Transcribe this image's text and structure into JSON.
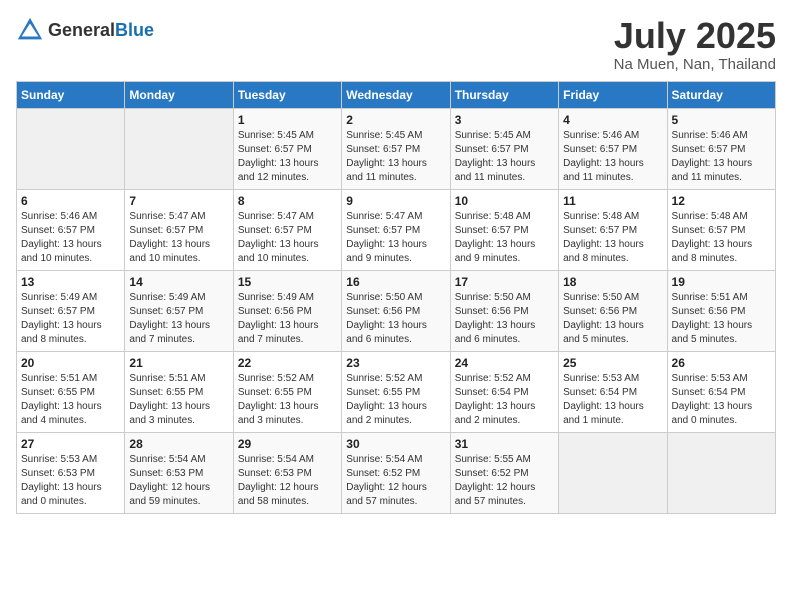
{
  "header": {
    "logo_general": "General",
    "logo_blue": "Blue",
    "month": "July 2025",
    "location": "Na Muen, Nan, Thailand"
  },
  "days_of_week": [
    "Sunday",
    "Monday",
    "Tuesday",
    "Wednesday",
    "Thursday",
    "Friday",
    "Saturday"
  ],
  "weeks": [
    [
      {
        "day": "",
        "sunrise": "",
        "sunset": "",
        "daylight": "",
        "empty": true
      },
      {
        "day": "",
        "sunrise": "",
        "sunset": "",
        "daylight": "",
        "empty": true
      },
      {
        "day": "1",
        "sunrise": "Sunrise: 5:45 AM",
        "sunset": "Sunset: 6:57 PM",
        "daylight": "Daylight: 13 hours and 12 minutes."
      },
      {
        "day": "2",
        "sunrise": "Sunrise: 5:45 AM",
        "sunset": "Sunset: 6:57 PM",
        "daylight": "Daylight: 13 hours and 11 minutes."
      },
      {
        "day": "3",
        "sunrise": "Sunrise: 5:45 AM",
        "sunset": "Sunset: 6:57 PM",
        "daylight": "Daylight: 13 hours and 11 minutes."
      },
      {
        "day": "4",
        "sunrise": "Sunrise: 5:46 AM",
        "sunset": "Sunset: 6:57 PM",
        "daylight": "Daylight: 13 hours and 11 minutes."
      },
      {
        "day": "5",
        "sunrise": "Sunrise: 5:46 AM",
        "sunset": "Sunset: 6:57 PM",
        "daylight": "Daylight: 13 hours and 11 minutes."
      }
    ],
    [
      {
        "day": "6",
        "sunrise": "Sunrise: 5:46 AM",
        "sunset": "Sunset: 6:57 PM",
        "daylight": "Daylight: 13 hours and 10 minutes."
      },
      {
        "day": "7",
        "sunrise": "Sunrise: 5:47 AM",
        "sunset": "Sunset: 6:57 PM",
        "daylight": "Daylight: 13 hours and 10 minutes."
      },
      {
        "day": "8",
        "sunrise": "Sunrise: 5:47 AM",
        "sunset": "Sunset: 6:57 PM",
        "daylight": "Daylight: 13 hours and 10 minutes."
      },
      {
        "day": "9",
        "sunrise": "Sunrise: 5:47 AM",
        "sunset": "Sunset: 6:57 PM",
        "daylight": "Daylight: 13 hours and 9 minutes."
      },
      {
        "day": "10",
        "sunrise": "Sunrise: 5:48 AM",
        "sunset": "Sunset: 6:57 PM",
        "daylight": "Daylight: 13 hours and 9 minutes."
      },
      {
        "day": "11",
        "sunrise": "Sunrise: 5:48 AM",
        "sunset": "Sunset: 6:57 PM",
        "daylight": "Daylight: 13 hours and 8 minutes."
      },
      {
        "day": "12",
        "sunrise": "Sunrise: 5:48 AM",
        "sunset": "Sunset: 6:57 PM",
        "daylight": "Daylight: 13 hours and 8 minutes."
      }
    ],
    [
      {
        "day": "13",
        "sunrise": "Sunrise: 5:49 AM",
        "sunset": "Sunset: 6:57 PM",
        "daylight": "Daylight: 13 hours and 8 minutes."
      },
      {
        "day": "14",
        "sunrise": "Sunrise: 5:49 AM",
        "sunset": "Sunset: 6:57 PM",
        "daylight": "Daylight: 13 hours and 7 minutes."
      },
      {
        "day": "15",
        "sunrise": "Sunrise: 5:49 AM",
        "sunset": "Sunset: 6:56 PM",
        "daylight": "Daylight: 13 hours and 7 minutes."
      },
      {
        "day": "16",
        "sunrise": "Sunrise: 5:50 AM",
        "sunset": "Sunset: 6:56 PM",
        "daylight": "Daylight: 13 hours and 6 minutes."
      },
      {
        "day": "17",
        "sunrise": "Sunrise: 5:50 AM",
        "sunset": "Sunset: 6:56 PM",
        "daylight": "Daylight: 13 hours and 6 minutes."
      },
      {
        "day": "18",
        "sunrise": "Sunrise: 5:50 AM",
        "sunset": "Sunset: 6:56 PM",
        "daylight": "Daylight: 13 hours and 5 minutes."
      },
      {
        "day": "19",
        "sunrise": "Sunrise: 5:51 AM",
        "sunset": "Sunset: 6:56 PM",
        "daylight": "Daylight: 13 hours and 5 minutes."
      }
    ],
    [
      {
        "day": "20",
        "sunrise": "Sunrise: 5:51 AM",
        "sunset": "Sunset: 6:55 PM",
        "daylight": "Daylight: 13 hours and 4 minutes."
      },
      {
        "day": "21",
        "sunrise": "Sunrise: 5:51 AM",
        "sunset": "Sunset: 6:55 PM",
        "daylight": "Daylight: 13 hours and 3 minutes."
      },
      {
        "day": "22",
        "sunrise": "Sunrise: 5:52 AM",
        "sunset": "Sunset: 6:55 PM",
        "daylight": "Daylight: 13 hours and 3 minutes."
      },
      {
        "day": "23",
        "sunrise": "Sunrise: 5:52 AM",
        "sunset": "Sunset: 6:55 PM",
        "daylight": "Daylight: 13 hours and 2 minutes."
      },
      {
        "day": "24",
        "sunrise": "Sunrise: 5:52 AM",
        "sunset": "Sunset: 6:54 PM",
        "daylight": "Daylight: 13 hours and 2 minutes."
      },
      {
        "day": "25",
        "sunrise": "Sunrise: 5:53 AM",
        "sunset": "Sunset: 6:54 PM",
        "daylight": "Daylight: 13 hours and 1 minute."
      },
      {
        "day": "26",
        "sunrise": "Sunrise: 5:53 AM",
        "sunset": "Sunset: 6:54 PM",
        "daylight": "Daylight: 13 hours and 0 minutes."
      }
    ],
    [
      {
        "day": "27",
        "sunrise": "Sunrise: 5:53 AM",
        "sunset": "Sunset: 6:53 PM",
        "daylight": "Daylight: 13 hours and 0 minutes."
      },
      {
        "day": "28",
        "sunrise": "Sunrise: 5:54 AM",
        "sunset": "Sunset: 6:53 PM",
        "daylight": "Daylight: 12 hours and 59 minutes."
      },
      {
        "day": "29",
        "sunrise": "Sunrise: 5:54 AM",
        "sunset": "Sunset: 6:53 PM",
        "daylight": "Daylight: 12 hours and 58 minutes."
      },
      {
        "day": "30",
        "sunrise": "Sunrise: 5:54 AM",
        "sunset": "Sunset: 6:52 PM",
        "daylight": "Daylight: 12 hours and 57 minutes."
      },
      {
        "day": "31",
        "sunrise": "Sunrise: 5:55 AM",
        "sunset": "Sunset: 6:52 PM",
        "daylight": "Daylight: 12 hours and 57 minutes."
      },
      {
        "day": "",
        "sunrise": "",
        "sunset": "",
        "daylight": "",
        "empty": true
      },
      {
        "day": "",
        "sunrise": "",
        "sunset": "",
        "daylight": "",
        "empty": true
      }
    ]
  ]
}
